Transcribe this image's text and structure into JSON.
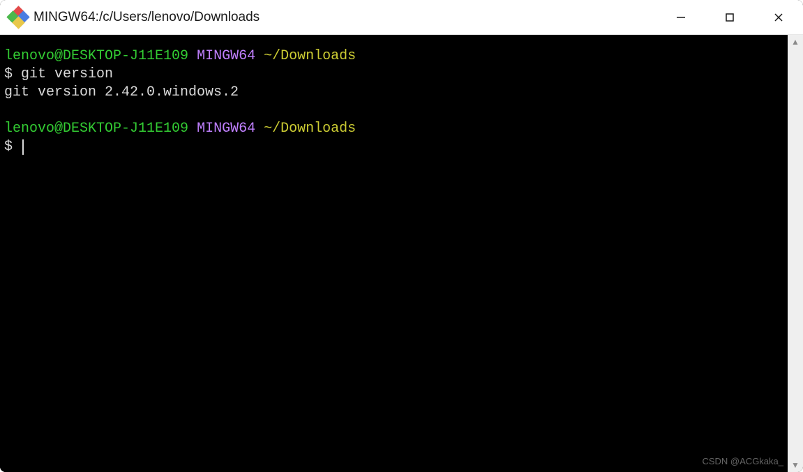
{
  "titlebar": {
    "title": "MINGW64:/c/Users/lenovo/Downloads"
  },
  "terminal": {
    "lines": [
      {
        "user_host": "lenovo@DESKTOP-J11E109",
        "env": "MINGW64",
        "path": "~/Downloads"
      },
      {
        "prompt": "$",
        "command": "git version"
      },
      {
        "output": "git version 2.42.0.windows.2"
      },
      {
        "blank": true
      },
      {
        "user_host": "lenovo@DESKTOP-J11E109",
        "env": "MINGW64",
        "path": "~/Downloads"
      },
      {
        "prompt": "$",
        "cursor": true
      }
    ]
  },
  "watermark": "CSDN @ACGkaka_"
}
